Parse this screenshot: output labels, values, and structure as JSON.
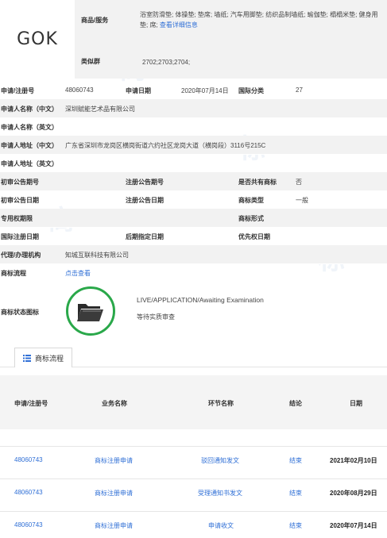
{
  "logo_text": "GOK",
  "header": {
    "goods_label": "商品/服务",
    "goods_value": "浴室防滑垫; 体操垫; 垫席; 墙纸; 汽车用脚垫; 纺织品制墙纸; 瑜伽垫; 榻榻米垫; 健身用垫; 席;",
    "goods_link": "查看详细信息",
    "similar_label": "类似群",
    "similar_value": "2702;2703;2704;"
  },
  "info": {
    "reg_no_label": "申请/注册号",
    "reg_no": "48060743",
    "apply_date_label": "申请日期",
    "apply_date": "2020年07月14日",
    "intl_class_label": "国际分类",
    "intl_class": "27",
    "applicant_cn_label": "申请人名称（中文）",
    "applicant_cn": "深圳赋能艺术品有限公司",
    "applicant_en_label": "申请人名称（英文）",
    "applicant_en": "",
    "address_cn_label": "申请人地址（中文）",
    "address_cn": "广东省深圳市龙岗区横岗街道六约社区龙岗大道（横岗段）3116号215C",
    "address_en_label": "申请人地址（英文）",
    "address_en": "",
    "prelim_pub_no_label": "初审公告期号",
    "prelim_pub_no": "",
    "reg_pub_no_label": "注册公告期号",
    "reg_pub_no": "",
    "shared_label": "是否共有商标",
    "shared": "否",
    "prelim_pub_date_label": "初审公告日期",
    "prelim_pub_date": "",
    "reg_pub_date_label": "注册公告日期",
    "reg_pub_date": "",
    "tm_type_label": "商标类型",
    "tm_type": "一般",
    "exclusive_period_label": "专用权期限",
    "exclusive_period": "",
    "tm_form_label": "商标形式",
    "tm_form": "",
    "intl_reg_date_label": "国际注册日期",
    "intl_reg_date": "",
    "later_date_label": "后期指定日期",
    "later_date": "",
    "priority_date_label": "优先权日期",
    "priority_date": "",
    "agent_label": "代理/办理机构",
    "agent": "知城互联科技有限公司",
    "process_label": "商标流程",
    "process_link": "点击查看",
    "status_icon_label": "商标状态图标",
    "status_text": "LIVE/APPLICATION/Awaiting Examination",
    "status_cn": "等待实质审查"
  },
  "flow": {
    "tab_label": "商标流程",
    "columns": [
      "申请/注册号",
      "业务名称",
      "环节名称",
      "结论",
      "日期"
    ],
    "rows": [
      {
        "no": "48060743",
        "business": "商标注册申请",
        "step": "驳回通知发文",
        "result": "结束",
        "date": "2021年02月10日"
      },
      {
        "no": "48060743",
        "business": "商标注册申请",
        "step": "受理通知书发文",
        "result": "结束",
        "date": "2020年08月29日"
      },
      {
        "no": "48060743",
        "business": "商标注册申请",
        "step": "申请收文",
        "result": "结束",
        "date": "2020年07月14日"
      }
    ]
  },
  "colors": {
    "link": "#2f6fd6",
    "status_ring": "#2aa84a",
    "row_alt": "#f2f2f2"
  },
  "icons": [
    "folder-icon",
    "list-icon"
  ]
}
